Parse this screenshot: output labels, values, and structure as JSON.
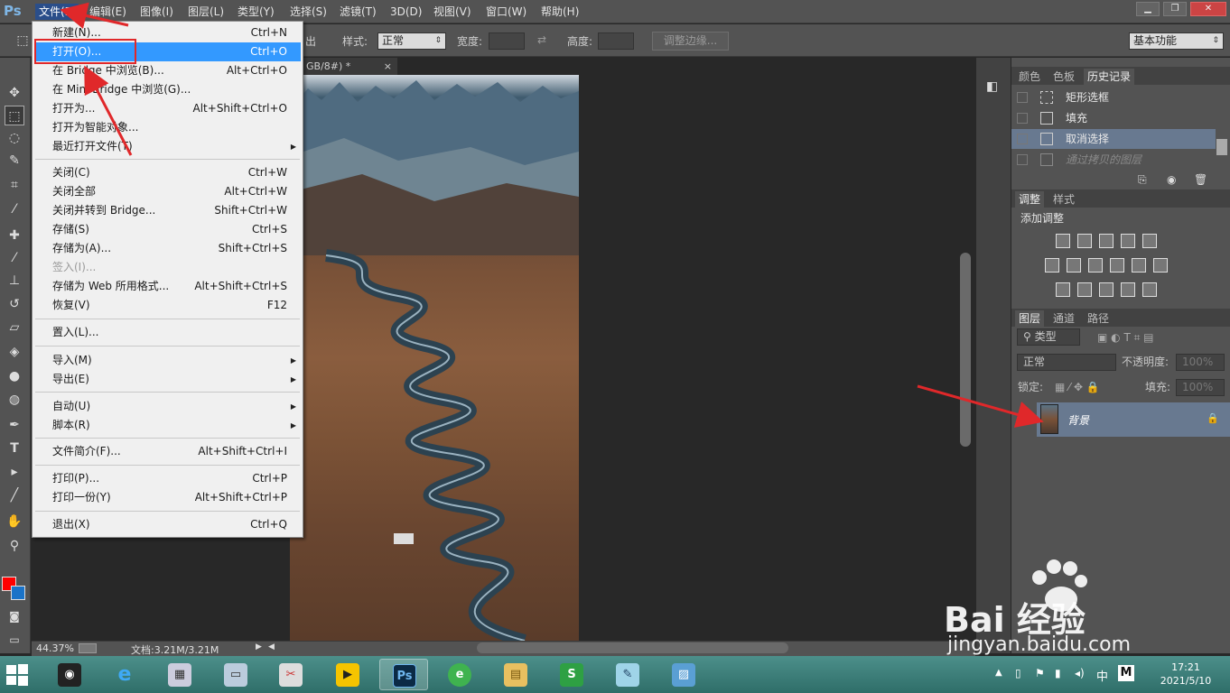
{
  "menubar": {
    "logo": "Ps",
    "items": [
      "文件(F)",
      "编辑(E)",
      "图像(I)",
      "图层(L)",
      "类型(Y)",
      "选择(S)",
      "滤镜(T)",
      "3D(D)",
      "视图(V)",
      "窗口(W)",
      "帮助(H)"
    ],
    "active_index": 0
  },
  "options": {
    "tail_label": "出",
    "style_label": "样式:",
    "style_value": "正常",
    "width_label": "宽度:",
    "height_label": "高度:",
    "refine_button": "调整边缘...",
    "workspace": "基本功能"
  },
  "document": {
    "tab_title": "GB/8#) *",
    "zoom": "44.37%",
    "doc_size": "文档:3.21M/3.21M"
  },
  "file_menu": {
    "items": [
      {
        "label": "新建(N)...",
        "shortcut": "Ctrl+N"
      },
      {
        "label": "打开(O)...",
        "shortcut": "Ctrl+O",
        "highlighted": true
      },
      {
        "label": "在 Bridge 中浏览(B)...",
        "shortcut": "Alt+Ctrl+O"
      },
      {
        "label": "在 Mini Bridge 中浏览(G)...",
        "shortcut": ""
      },
      {
        "label": "打开为...",
        "shortcut": "Alt+Shift+Ctrl+O"
      },
      {
        "label": "打开为智能对象...",
        "shortcut": ""
      },
      {
        "label": "最近打开文件(T)",
        "shortcut": "",
        "submenu": true
      },
      {
        "label": "关闭(C)",
        "shortcut": "Ctrl+W"
      },
      {
        "label": "关闭全部",
        "shortcut": "Alt+Ctrl+W"
      },
      {
        "label": "关闭并转到 Bridge...",
        "shortcut": "Shift+Ctrl+W"
      },
      {
        "label": "存储(S)",
        "shortcut": "Ctrl+S"
      },
      {
        "label": "存储为(A)...",
        "shortcut": "Shift+Ctrl+S"
      },
      {
        "label": "签入(I)...",
        "shortcut": "",
        "disabled": true
      },
      {
        "label": "存储为 Web 所用格式...",
        "shortcut": "Alt+Shift+Ctrl+S"
      },
      {
        "label": "恢复(V)",
        "shortcut": "F12"
      },
      {
        "label": "置入(L)...",
        "shortcut": ""
      },
      {
        "label": "导入(M)",
        "shortcut": "",
        "submenu": true
      },
      {
        "label": "导出(E)",
        "shortcut": "",
        "submenu": true
      },
      {
        "label": "自动(U)",
        "shortcut": "",
        "submenu": true
      },
      {
        "label": "脚本(R)",
        "shortcut": "",
        "submenu": true
      },
      {
        "label": "文件简介(F)...",
        "shortcut": "Alt+Shift+Ctrl+I"
      },
      {
        "label": "打印(P)...",
        "shortcut": "Ctrl+P"
      },
      {
        "label": "打印一份(Y)",
        "shortcut": "Alt+Shift+Ctrl+P"
      },
      {
        "label": "退出(X)",
        "shortcut": "Ctrl+Q"
      }
    ]
  },
  "history_panel": {
    "tabs": [
      "颜色",
      "色板",
      "历史记录"
    ],
    "rows": [
      {
        "label": "矩形选框"
      },
      {
        "label": "填充"
      },
      {
        "label": "取消选择",
        "selected": true
      },
      {
        "label": "通过拷贝的图层",
        "dimmed": true
      }
    ]
  },
  "adjustments_panel": {
    "tabs": [
      "调整",
      "样式"
    ],
    "title": "添加调整"
  },
  "layers_panel": {
    "tabs": [
      "图层",
      "通道",
      "路径"
    ],
    "filter": "类型",
    "blend_mode": "正常",
    "opacity_label": "不透明度:",
    "opacity_value": "100%",
    "lock_label": "锁定:",
    "fill_label": "填充:",
    "fill_value": "100%",
    "layer_name": "背景"
  },
  "taskbar": {
    "time": "17:21",
    "date": "2021/5/10",
    "ime": "中",
    "ime_mode": "M"
  },
  "watermark": {
    "brand": "Bai 经验",
    "url": "jingyan.baidu.com"
  },
  "colors": {
    "menu_highlight": "#3399ff",
    "annotation_red": "#e0282a",
    "foreground": "#ff0000",
    "background": "#1a73c8"
  }
}
